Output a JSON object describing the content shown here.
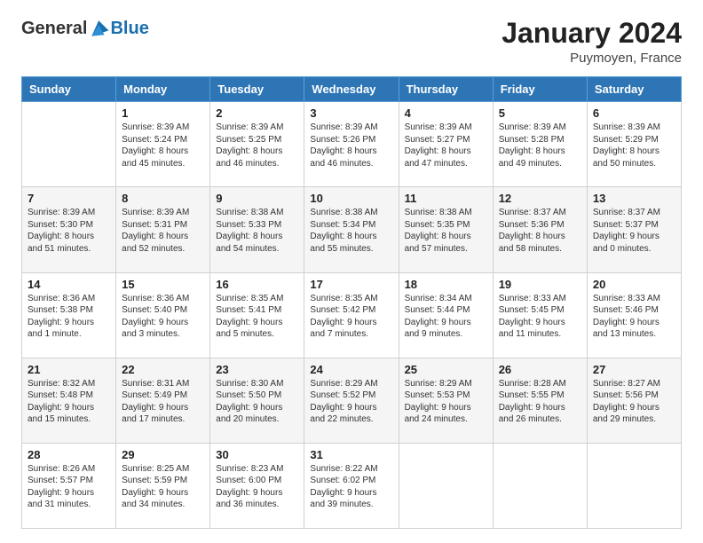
{
  "header": {
    "logo_general": "General",
    "logo_blue": "Blue",
    "main_title": "January 2024",
    "subtitle": "Puymoyen, France"
  },
  "calendar": {
    "days": [
      "Sunday",
      "Monday",
      "Tuesday",
      "Wednesday",
      "Thursday",
      "Friday",
      "Saturday"
    ],
    "weeks": [
      [
        {
          "date": "",
          "info": ""
        },
        {
          "date": "1",
          "info": "Sunrise: 8:39 AM\nSunset: 5:24 PM\nDaylight: 8 hours\nand 45 minutes."
        },
        {
          "date": "2",
          "info": "Sunrise: 8:39 AM\nSunset: 5:25 PM\nDaylight: 8 hours\nand 46 minutes."
        },
        {
          "date": "3",
          "info": "Sunrise: 8:39 AM\nSunset: 5:26 PM\nDaylight: 8 hours\nand 46 minutes."
        },
        {
          "date": "4",
          "info": "Sunrise: 8:39 AM\nSunset: 5:27 PM\nDaylight: 8 hours\nand 47 minutes."
        },
        {
          "date": "5",
          "info": "Sunrise: 8:39 AM\nSunset: 5:28 PM\nDaylight: 8 hours\nand 49 minutes."
        },
        {
          "date": "6",
          "info": "Sunrise: 8:39 AM\nSunset: 5:29 PM\nDaylight: 8 hours\nand 50 minutes."
        }
      ],
      [
        {
          "date": "7",
          "info": "Sunrise: 8:39 AM\nSunset: 5:30 PM\nDaylight: 8 hours\nand 51 minutes."
        },
        {
          "date": "8",
          "info": "Sunrise: 8:39 AM\nSunset: 5:31 PM\nDaylight: 8 hours\nand 52 minutes."
        },
        {
          "date": "9",
          "info": "Sunrise: 8:38 AM\nSunset: 5:33 PM\nDaylight: 8 hours\nand 54 minutes."
        },
        {
          "date": "10",
          "info": "Sunrise: 8:38 AM\nSunset: 5:34 PM\nDaylight: 8 hours\nand 55 minutes."
        },
        {
          "date": "11",
          "info": "Sunrise: 8:38 AM\nSunset: 5:35 PM\nDaylight: 8 hours\nand 57 minutes."
        },
        {
          "date": "12",
          "info": "Sunrise: 8:37 AM\nSunset: 5:36 PM\nDaylight: 8 hours\nand 58 minutes."
        },
        {
          "date": "13",
          "info": "Sunrise: 8:37 AM\nSunset: 5:37 PM\nDaylight: 9 hours\nand 0 minutes."
        }
      ],
      [
        {
          "date": "14",
          "info": "Sunrise: 8:36 AM\nSunset: 5:38 PM\nDaylight: 9 hours\nand 1 minute."
        },
        {
          "date": "15",
          "info": "Sunrise: 8:36 AM\nSunset: 5:40 PM\nDaylight: 9 hours\nand 3 minutes."
        },
        {
          "date": "16",
          "info": "Sunrise: 8:35 AM\nSunset: 5:41 PM\nDaylight: 9 hours\nand 5 minutes."
        },
        {
          "date": "17",
          "info": "Sunrise: 8:35 AM\nSunset: 5:42 PM\nDaylight: 9 hours\nand 7 minutes."
        },
        {
          "date": "18",
          "info": "Sunrise: 8:34 AM\nSunset: 5:44 PM\nDaylight: 9 hours\nand 9 minutes."
        },
        {
          "date": "19",
          "info": "Sunrise: 8:33 AM\nSunset: 5:45 PM\nDaylight: 9 hours\nand 11 minutes."
        },
        {
          "date": "20",
          "info": "Sunrise: 8:33 AM\nSunset: 5:46 PM\nDaylight: 9 hours\nand 13 minutes."
        }
      ],
      [
        {
          "date": "21",
          "info": "Sunrise: 8:32 AM\nSunset: 5:48 PM\nDaylight: 9 hours\nand 15 minutes."
        },
        {
          "date": "22",
          "info": "Sunrise: 8:31 AM\nSunset: 5:49 PM\nDaylight: 9 hours\nand 17 minutes."
        },
        {
          "date": "23",
          "info": "Sunrise: 8:30 AM\nSunset: 5:50 PM\nDaylight: 9 hours\nand 20 minutes."
        },
        {
          "date": "24",
          "info": "Sunrise: 8:29 AM\nSunset: 5:52 PM\nDaylight: 9 hours\nand 22 minutes."
        },
        {
          "date": "25",
          "info": "Sunrise: 8:29 AM\nSunset: 5:53 PM\nDaylight: 9 hours\nand 24 minutes."
        },
        {
          "date": "26",
          "info": "Sunrise: 8:28 AM\nSunset: 5:55 PM\nDaylight: 9 hours\nand 26 minutes."
        },
        {
          "date": "27",
          "info": "Sunrise: 8:27 AM\nSunset: 5:56 PM\nDaylight: 9 hours\nand 29 minutes."
        }
      ],
      [
        {
          "date": "28",
          "info": "Sunrise: 8:26 AM\nSunset: 5:57 PM\nDaylight: 9 hours\nand 31 minutes."
        },
        {
          "date": "29",
          "info": "Sunrise: 8:25 AM\nSunset: 5:59 PM\nDaylight: 9 hours\nand 34 minutes."
        },
        {
          "date": "30",
          "info": "Sunrise: 8:23 AM\nSunset: 6:00 PM\nDaylight: 9 hours\nand 36 minutes."
        },
        {
          "date": "31",
          "info": "Sunrise: 8:22 AM\nSunset: 6:02 PM\nDaylight: 9 hours\nand 39 minutes."
        },
        {
          "date": "",
          "info": ""
        },
        {
          "date": "",
          "info": ""
        },
        {
          "date": "",
          "info": ""
        }
      ]
    ]
  }
}
